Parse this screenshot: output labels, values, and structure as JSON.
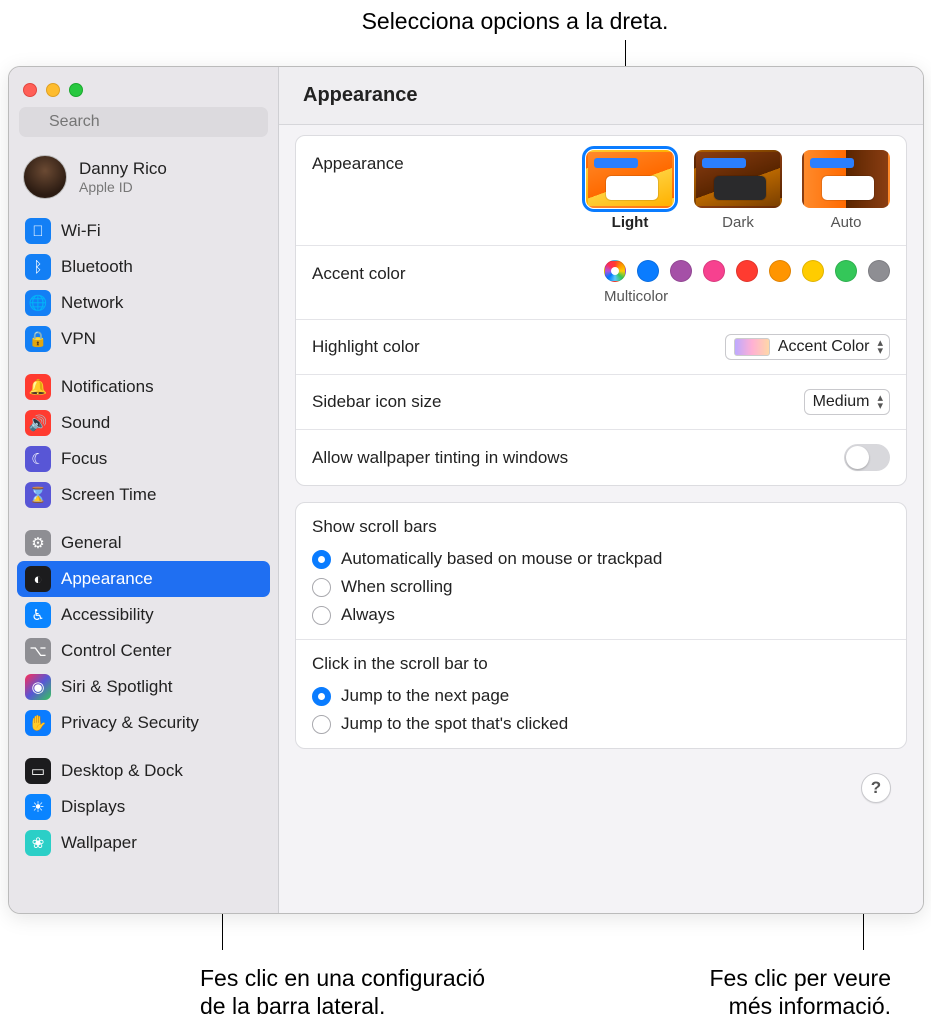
{
  "callouts": {
    "top": "Selecciona opcions a la dreta.",
    "bottom_left_l1": "Fes clic en una configuració",
    "bottom_left_l2": "de la barra lateral.",
    "bottom_right_l1": "Fes clic per veure",
    "bottom_right_l2": "més informació."
  },
  "window": {
    "title": "Appearance",
    "search_placeholder": "Search"
  },
  "user": {
    "name": "Danny Rico",
    "subtitle": "Apple ID"
  },
  "sidebar": {
    "g1": [
      {
        "label": "Wi-Fi",
        "icon": "wifi"
      },
      {
        "label": "Bluetooth",
        "icon": "bt"
      },
      {
        "label": "Network",
        "icon": "net"
      },
      {
        "label": "VPN",
        "icon": "vpn"
      }
    ],
    "g2": [
      {
        "label": "Notifications",
        "icon": "notif"
      },
      {
        "label": "Sound",
        "icon": "sound"
      },
      {
        "label": "Focus",
        "icon": "focus"
      },
      {
        "label": "Screen Time",
        "icon": "screentime"
      }
    ],
    "g3": [
      {
        "label": "General",
        "icon": "general"
      },
      {
        "label": "Appearance",
        "icon": "appearance",
        "selected": true
      },
      {
        "label": "Accessibility",
        "icon": "access"
      },
      {
        "label": "Control Center",
        "icon": "cc"
      },
      {
        "label": "Siri & Spotlight",
        "icon": "siri"
      },
      {
        "label": "Privacy & Security",
        "icon": "privacy"
      }
    ],
    "g4": [
      {
        "label": "Desktop & Dock",
        "icon": "desktop"
      },
      {
        "label": "Displays",
        "icon": "displays"
      },
      {
        "label": "Wallpaper",
        "icon": "wallpaper"
      }
    ]
  },
  "settings": {
    "appearance_label": "Appearance",
    "appearance_options": {
      "light": "Light",
      "dark": "Dark",
      "auto": "Auto"
    },
    "appearance_selected": "light",
    "accent_label": "Accent color",
    "accent_caption": "Multicolor",
    "accent_colors": [
      "multi",
      "blue",
      "purple",
      "pink",
      "red",
      "orange",
      "yellow",
      "green",
      "gray"
    ],
    "accent_selected": "multi",
    "highlight_label": "Highlight color",
    "highlight_value": "Accent Color",
    "sidebar_icon_label": "Sidebar icon size",
    "sidebar_icon_value": "Medium",
    "tinting_label": "Allow wallpaper tinting in windows",
    "tinting_on": false,
    "scroll_title": "Show scroll bars",
    "scroll_options": {
      "auto": "Automatically based on mouse or trackpad",
      "scrolling": "When scrolling",
      "always": "Always"
    },
    "scroll_selected": "auto",
    "click_title": "Click in the scroll bar to",
    "click_options": {
      "next": "Jump to the next page",
      "spot": "Jump to the spot that's clicked"
    },
    "click_selected": "next"
  },
  "help_label": "?"
}
